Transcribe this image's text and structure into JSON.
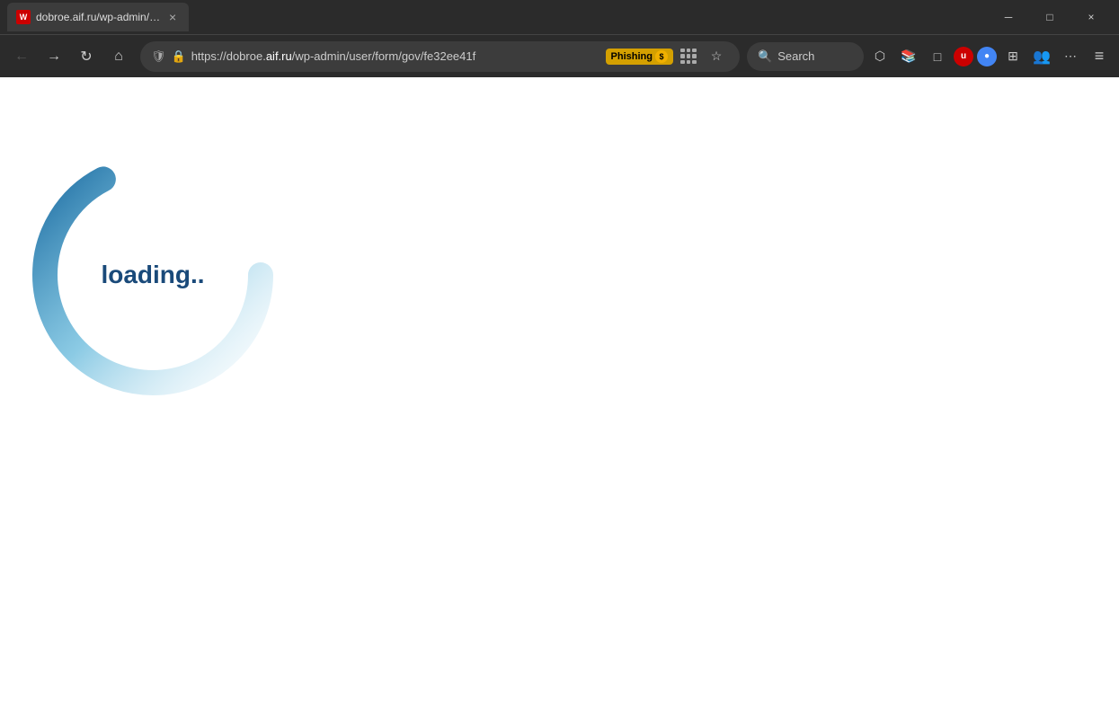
{
  "browser": {
    "title_bar": {
      "tab_title": "dobroe.aif.ru/wp-admin/…",
      "tab_favicon_label": "W",
      "close_label": "×",
      "minimize_label": "─",
      "maximize_label": "□"
    },
    "nav_bar": {
      "url_prefix": "https://dobroe.",
      "url_domain": "aif.ru",
      "url_suffix": "/wp-admin/user/form/gov/fe32ee41f",
      "phishing_label": "Phishing",
      "search_placeholder": "Search",
      "back_label": "←",
      "forward_label": "→",
      "reload_label": "↻",
      "home_label": "⌂",
      "shield_label": "🛡",
      "lock_label": "🔒",
      "bookmark_label": "☆",
      "extensions_label": "⊞",
      "library_label": "📚",
      "tabs_label": "□",
      "more_label": "⋯",
      "menu_label": "≡"
    },
    "page": {
      "loading_text": "loading.."
    }
  }
}
